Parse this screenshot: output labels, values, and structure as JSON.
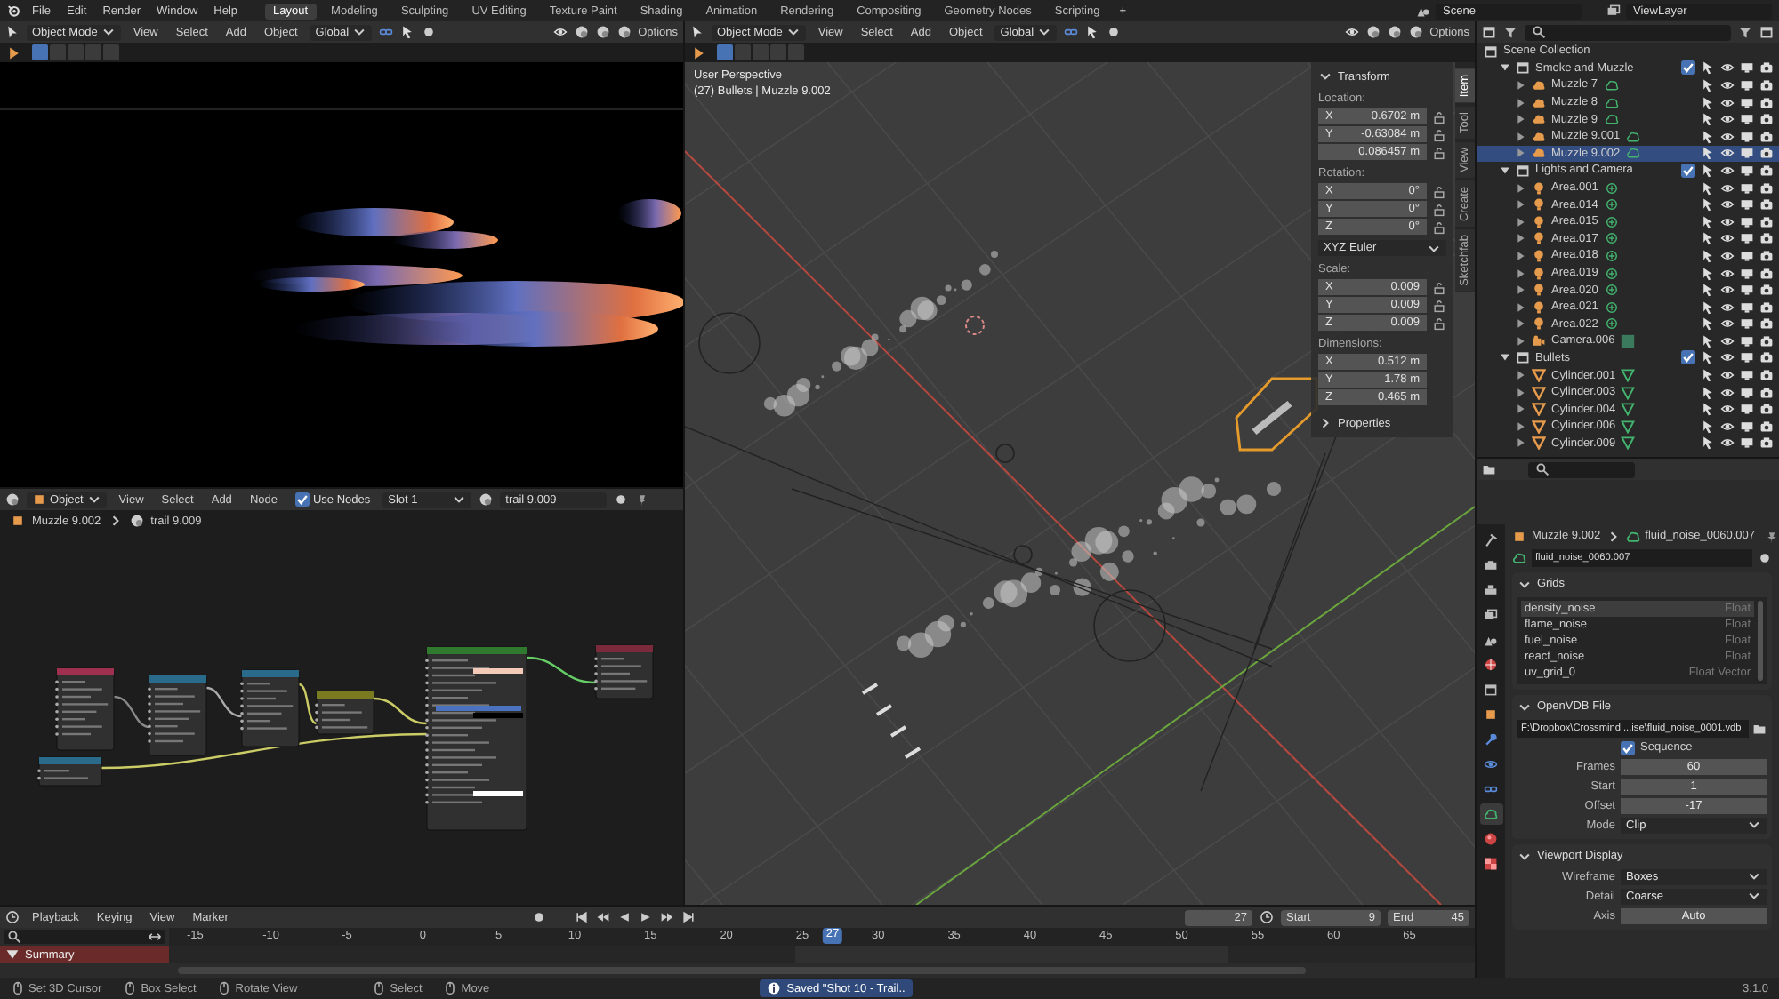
{
  "top_bar": {
    "menus": [
      "File",
      "Edit",
      "Render",
      "Window",
      "Help"
    ],
    "workspaces": [
      {
        "label": "Layout",
        "selected": true
      },
      {
        "label": "Modeling",
        "selected": false
      },
      {
        "label": "Sculpting",
        "selected": false
      },
      {
        "label": "UV Editing",
        "selected": false
      },
      {
        "label": "Texture Paint",
        "selected": false
      },
      {
        "label": "Shading",
        "selected": false
      },
      {
        "label": "Animation",
        "selected": false
      },
      {
        "label": "Rendering",
        "selected": false
      },
      {
        "label": "Compositing",
        "selected": false
      },
      {
        "label": "Geometry Nodes",
        "selected": false
      },
      {
        "label": "Scripting",
        "selected": false
      }
    ],
    "add_workspace": "+",
    "scene": "Scene",
    "view_layer": "ViewLayer"
  },
  "render_view": {
    "header": {
      "mode": "Object Mode",
      "menus": [
        "View",
        "Select",
        "Add",
        "Object"
      ],
      "orientation": "Global",
      "options": "Options"
    }
  },
  "node_editor": {
    "header": {
      "object_type": "Object",
      "menus": [
        "View",
        "Select",
        "Add",
        "Node"
      ],
      "use_nodes": {
        "label": "Use Nodes",
        "checked": true
      },
      "slot": "Slot 1",
      "material": "trail 9.009"
    },
    "breadcrumb": [
      "Muzzle 9.002",
      "trail 9.009"
    ]
  },
  "viewport": {
    "header": {
      "mode": "Object Mode",
      "menus": [
        "View",
        "Select",
        "Add",
        "Object"
      ],
      "orientation": "Global",
      "options": "Options"
    },
    "info": [
      "User Perspective",
      "(27) Bullets | Muzzle 9.002"
    ],
    "sidebar": {
      "tabs": [
        {
          "label": "Item",
          "selected": true
        },
        {
          "label": "Tool",
          "selected": false
        },
        {
          "label": "View",
          "selected": false
        },
        {
          "label": "Create",
          "selected": false
        },
        {
          "label": "Sketchfab",
          "selected": false
        }
      ],
      "panel": "Transform",
      "groups": [
        {
          "kind": "fields",
          "label": "Location:",
          "locks": true,
          "fields": [
            {
              "axis": "X",
              "value": "0.6702 m"
            },
            {
              "axis": "Y",
              "value": "-0.63084 m"
            },
            {
              "value": "0.086457 m"
            }
          ]
        },
        {
          "kind": "fields",
          "label": "Rotation:",
          "locks": true,
          "fields": [
            {
              "axis": "X",
              "value": "0°"
            },
            {
              "axis": "Y",
              "value": "0°"
            },
            {
              "axis": "Z",
              "value": "0°"
            }
          ]
        },
        {
          "kind": "dropdown",
          "value": "XYZ Euler"
        },
        {
          "kind": "fields",
          "label": "Scale:",
          "locks": true,
          "fields": [
            {
              "axis": "X",
              "value": "0.009"
            },
            {
              "axis": "Y",
              "value": "0.009"
            },
            {
              "axis": "Z",
              "value": "0.009"
            }
          ]
        },
        {
          "kind": "fields",
          "label": "Dimensions:",
          "locks": false,
          "fields": [
            {
              "axis": "X",
              "value": "0.512 m"
            },
            {
              "axis": "Y",
              "value": "1.78 m"
            },
            {
              "axis": "Z",
              "value": "0.465 m"
            }
          ]
        }
      ],
      "collapsed_panel": "Properties"
    }
  },
  "outliner": {
    "items": [
      {
        "name": "Scene Collection",
        "kind": "scene_collection",
        "children": [
          {
            "name": "Smoke and Muzzle",
            "kind": "collection",
            "expanded": true,
            "checked": true,
            "selected": false,
            "children": [
              {
                "name": "Muzzle 7",
                "kind": "volume",
                "expanded": false,
                "selected": false
              },
              {
                "name": "Muzzle 8",
                "kind": "volume",
                "expanded": false,
                "selected": false
              },
              {
                "name": "Muzzle 9",
                "kind": "volume",
                "expanded": false,
                "selected": false
              },
              {
                "name": "Muzzle 9.001",
                "kind": "volume",
                "expanded": false,
                "selected": false
              },
              {
                "name": "Muzzle 9.002",
                "kind": "volume",
                "expanded": false,
                "selected": true
              }
            ]
          },
          {
            "name": "Lights and Camera",
            "kind": "collection",
            "expanded": true,
            "checked": true,
            "selected": false,
            "children": [
              {
                "name": "Area.001",
                "kind": "light",
                "expanded": false,
                "selected": false
              },
              {
                "name": "Area.014",
                "kind": "light",
                "expanded": false,
                "selected": false
              },
              {
                "name": "Area.015",
                "kind": "light",
                "expanded": false,
                "selected": false
              },
              {
                "name": "Area.017",
                "kind": "light",
                "expanded": false,
                "selected": false
              },
              {
                "name": "Area.018",
                "kind": "light",
                "expanded": false,
                "selected": false
              },
              {
                "name": "Area.019",
                "kind": "light",
                "expanded": false,
                "selected": false
              },
              {
                "name": "Area.020",
                "kind": "light",
                "expanded": false,
                "selected": false
              },
              {
                "name": "Area.021",
                "kind": "light",
                "expanded": false,
                "selected": false
              },
              {
                "name": "Area.022",
                "kind": "light",
                "expanded": false,
                "selected": false
              },
              {
                "name": "Camera.006",
                "kind": "camera",
                "expanded": false,
                "selected": false
              }
            ]
          },
          {
            "name": "Bullets",
            "kind": "collection",
            "expanded": true,
            "checked": true,
            "selected": false,
            "children": [
              {
                "name": "Cylinder.001",
                "kind": "mesh",
                "expanded": false,
                "selected": false
              },
              {
                "name": "Cylinder.003",
                "kind": "mesh",
                "expanded": false,
                "selected": false
              },
              {
                "name": "Cylinder.004",
                "kind": "mesh",
                "expanded": false,
                "selected": false
              },
              {
                "name": "Cylinder.006",
                "kind": "mesh",
                "expanded": false,
                "selected": false
              },
              {
                "name": "Cylinder.009",
                "kind": "mesh",
                "expanded": false,
                "selected": false
              }
            ]
          }
        ]
      }
    ]
  },
  "properties": {
    "tabs": [
      {
        "kind": "tool",
        "selected": false
      },
      {
        "kind": "render",
        "selected": false
      },
      {
        "kind": "output",
        "selected": false
      },
      {
        "kind": "view_layer",
        "selected": false
      },
      {
        "kind": "scene",
        "selected": false
      },
      {
        "kind": "world",
        "selected": false
      },
      {
        "kind": "collection",
        "selected": false
      },
      {
        "kind": "object",
        "selected": false
      },
      {
        "kind": "modifiers",
        "selected": false
      },
      {
        "kind": "physics",
        "selected": false
      },
      {
        "kind": "constraints",
        "selected": false
      },
      {
        "kind": "data",
        "selected": true
      },
      {
        "kind": "material",
        "selected": false
      },
      {
        "kind": "texture",
        "selected": false
      }
    ],
    "breadcrumb": [
      "Muzzle 9.002",
      "fluid_noise_0060.007"
    ],
    "datablock": "fluid_noise_0060.007",
    "panels": [
      {
        "kind": "grids",
        "title": "Grids",
        "expanded": true,
        "rows": [
          {
            "name": "density_noise",
            "type": "Float",
            "selected": true
          },
          {
            "name": "flame_noise",
            "type": "Float",
            "selected": false
          },
          {
            "name": "fuel_noise",
            "type": "Float",
            "selected": false
          },
          {
            "name": "react_noise",
            "type": "Float",
            "selected": false
          },
          {
            "name": "uv_grid_0",
            "type": "Float Vector",
            "selected": false
          }
        ]
      },
      {
        "kind": "file",
        "title": "OpenVDB File",
        "expanded": true,
        "path": "F:\\Dropbox\\Crossmind ...ise\\fluid_noise_0001.vdb",
        "sequence": {
          "label": "Sequence",
          "checked": true
        },
        "fields": [
          {
            "label": "Frames",
            "value": "60",
            "dropdown": false
          },
          {
            "label": "Start",
            "value": "1",
            "dropdown": false
          },
          {
            "label": "Offset",
            "value": "-17",
            "dropdown": false
          },
          {
            "label": "Mode",
            "value": "Clip",
            "dropdown": true
          }
        ]
      },
      {
        "kind": "display",
        "title": "Viewport Display",
        "expanded": true,
        "fields": [
          {
            "label": "Wireframe",
            "value": "Boxes",
            "dropdown": true
          },
          {
            "label": "Detail",
            "value": "Coarse",
            "dropdown": true
          },
          {
            "label": "Axis",
            "value": "Auto",
            "dropdown": false
          }
        ]
      }
    ]
  },
  "timeline": {
    "header": {
      "menus": [
        "Playback",
        "Keying",
        "View",
        "Marker"
      ],
      "current_frame": "27",
      "start_label": "Start",
      "start": "9",
      "end_label": "End",
      "end": "45"
    },
    "ruler": [
      "-15",
      "-10",
      "-5",
      "0",
      "5",
      "10",
      "15",
      "20",
      "25",
      "30",
      "35",
      "40",
      "45",
      "50",
      "55",
      "60",
      "65"
    ],
    "current_frame": "27",
    "channels": [
      "Summary"
    ]
  },
  "status_bar": {
    "hints": [
      "Set 3D Cursor",
      "Box Select",
      "Rotate View",
      "Select",
      "Move"
    ],
    "message": "Saved \"Shot 10 - Trail..",
    "version": "3.1.0"
  }
}
